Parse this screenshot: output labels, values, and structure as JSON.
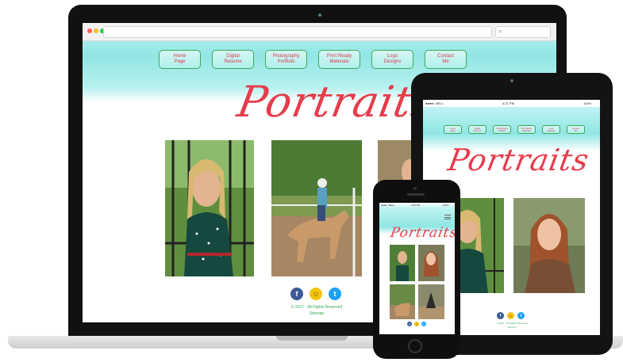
{
  "desktop": {
    "nav": [
      {
        "label": "Home\nPage"
      },
      {
        "label": "Digital\nResume"
      },
      {
        "label": "Photography\nPortfolio"
      },
      {
        "label": "Print Ready\nMaterials"
      },
      {
        "label": "Logo\nDesigns"
      },
      {
        "label": "Contact\nMe"
      }
    ],
    "title": "Portraits",
    "footer": {
      "copyright": "© 2017 - All Rights Reserved",
      "sitemap": "Sitemap"
    }
  },
  "tablet": {
    "status": {
      "carrier": "●●●●○ BELL",
      "time": "4:21 PM",
      "battery": "100%"
    },
    "nav": [
      {
        "label": "Home\nPage"
      },
      {
        "label": "Digital\nResume"
      },
      {
        "label": "Photography\nPortfolio"
      },
      {
        "label": "Print Ready\nMaterials"
      },
      {
        "label": "Logo\nDesigns"
      },
      {
        "label": "Contact\nMe"
      }
    ],
    "title": "Portraits",
    "footer": {
      "copyright": "© 2017 - All Rights Reserved",
      "sitemap": "Sitemap"
    }
  },
  "phone": {
    "status": {
      "carrier": "●●●●○ BELL",
      "time": "4:20 PM",
      "battery": "100%"
    },
    "title": "Portraits"
  },
  "icons": {
    "facebook": "f",
    "snapchat": "☺",
    "twitter": "t"
  },
  "colors": {
    "accent": "#e63c4b",
    "nav_border": "#3ea85a",
    "header_top": "#8fe6e3"
  }
}
